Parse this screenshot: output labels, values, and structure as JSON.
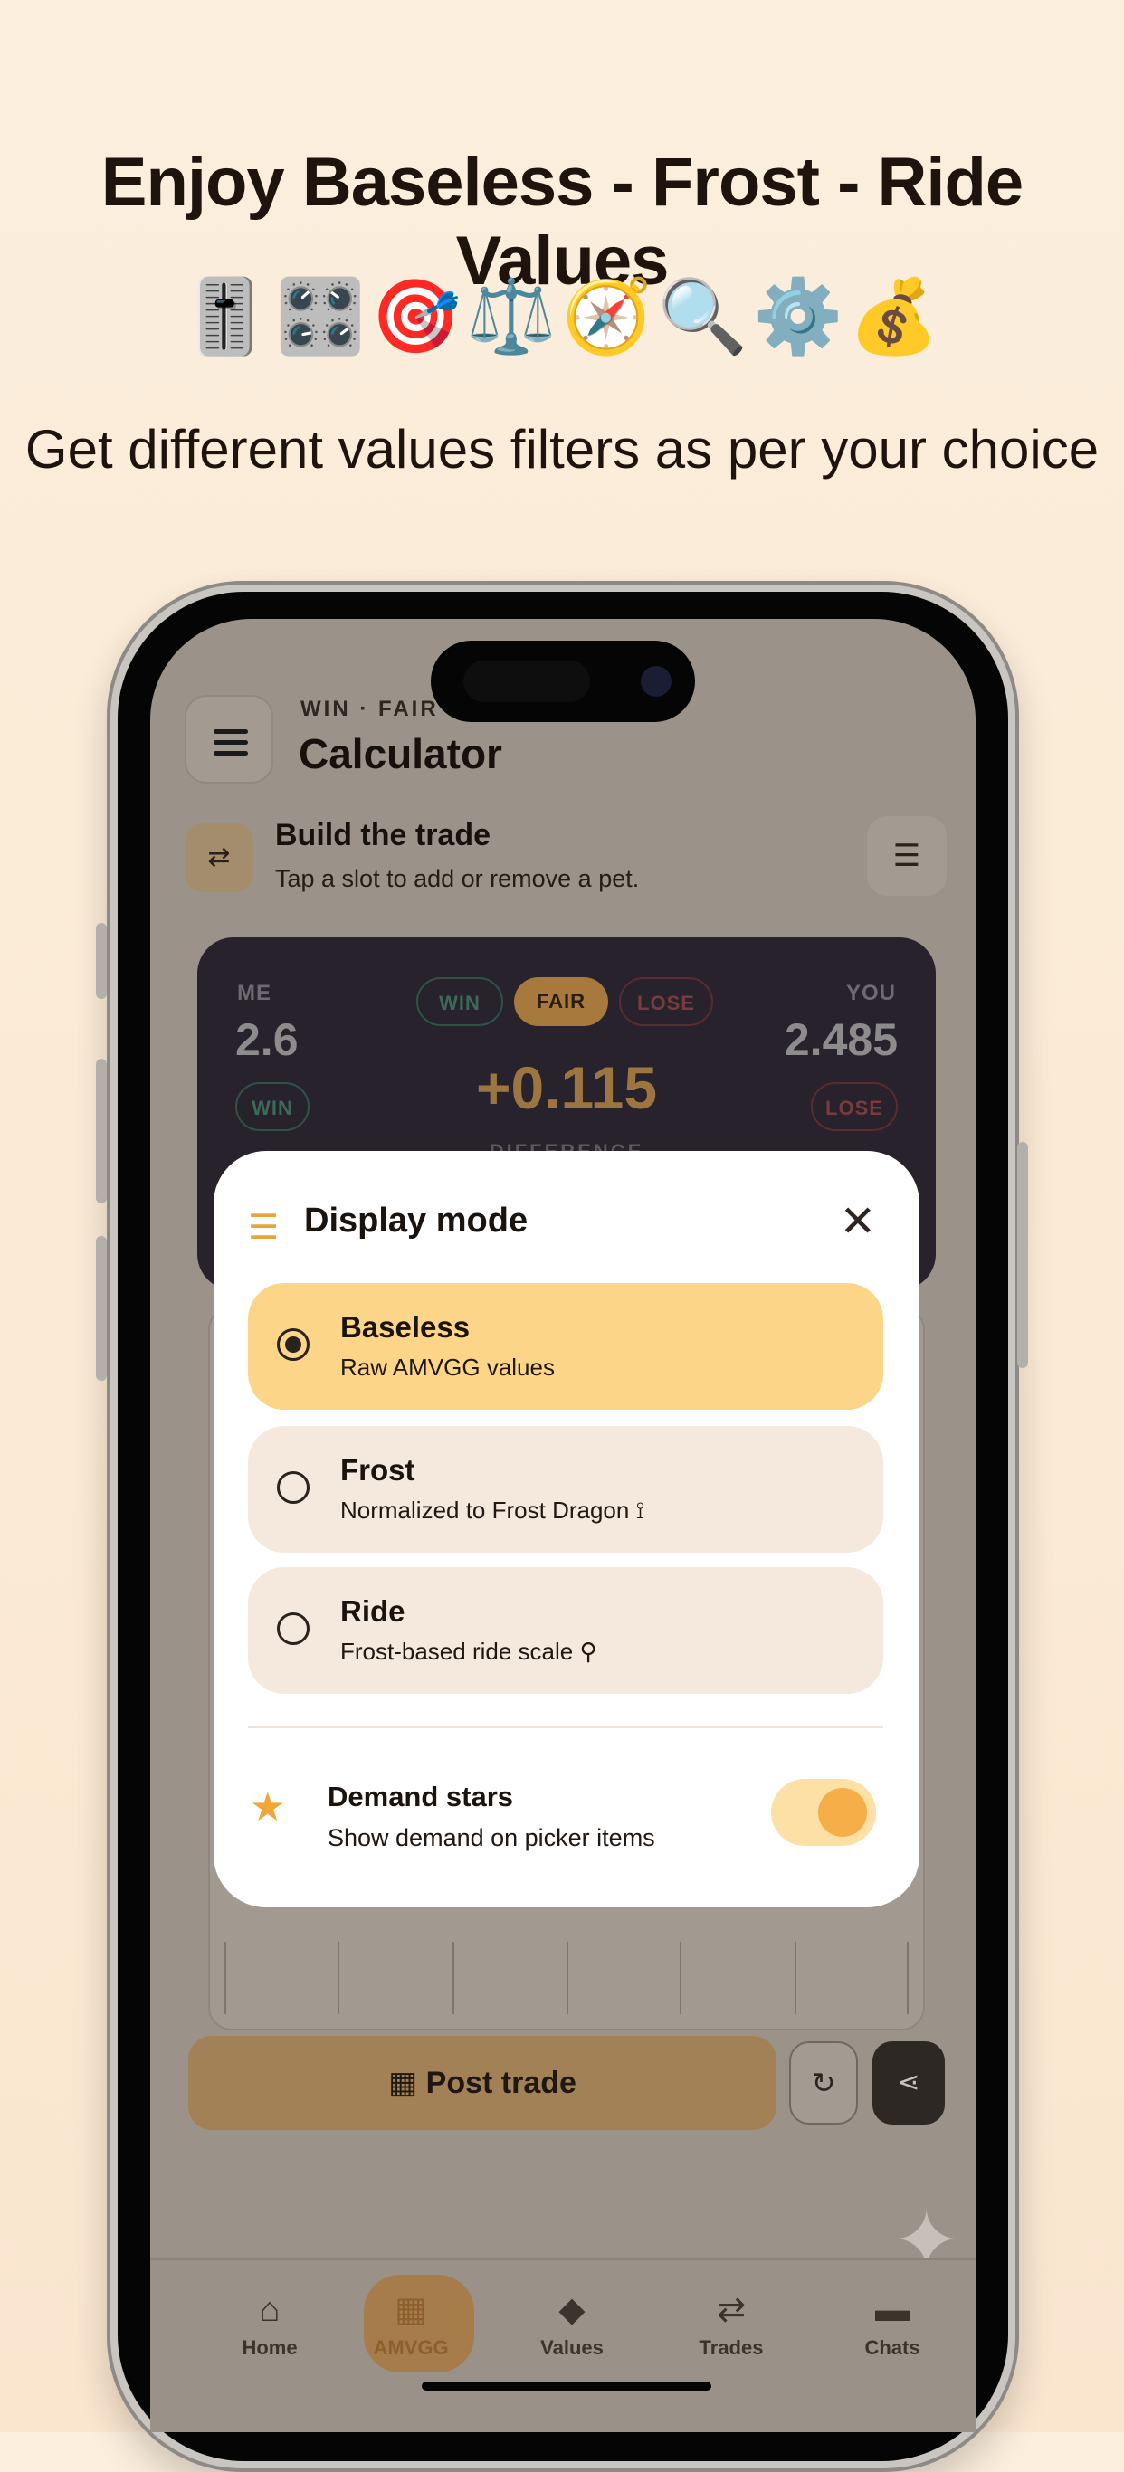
{
  "promo": {
    "headline": "Enjoy Baseless - Frost - Ride Values",
    "emojis": "🎚️🎛️🎯⚖️🧭🔍⚙️💰",
    "subheadline": "Get different values filters as per your choice"
  },
  "header": {
    "eyebrow": "WIN · FAIR ·",
    "title": "Calculator"
  },
  "build": {
    "title": "Build the trade",
    "subtitle": "Tap a slot to add or remove a pet."
  },
  "score": {
    "me_label": "ME",
    "me_value": "2.6",
    "me_chip": "WIN",
    "you_label": "YOU",
    "you_value": "2.485",
    "you_chip": "LOSE",
    "filters": [
      "WIN",
      "FAIR",
      "LOSE"
    ],
    "difference": "+0.115",
    "difference_label": "DIFFERENCE"
  },
  "actions": {
    "post_label": "Post trade"
  },
  "tabs": [
    {
      "label": "Home",
      "icon": "home-icon"
    },
    {
      "label": "AMVGG",
      "icon": "calculator-icon"
    },
    {
      "label": "Values",
      "icon": "diamond-icon"
    },
    {
      "label": "Trades",
      "icon": "swap-icon"
    },
    {
      "label": "Chats",
      "icon": "chat-icon"
    }
  ],
  "modal": {
    "title": "Display mode",
    "options": [
      {
        "title": "Baseless",
        "subtitle": "Raw AMVGG values",
        "selected": true
      },
      {
        "title": "Frost",
        "subtitle": "Normalized to Frost Dragon",
        "selected": false
      },
      {
        "title": "Ride",
        "subtitle": "Frost-based ride scale",
        "selected": false
      }
    ],
    "demand": {
      "title": "Demand stars",
      "subtitle": "Show demand on picker items",
      "enabled": true
    }
  },
  "colors": {
    "accent": "#F6AE48",
    "selected_option": "#FDD589",
    "background": "#FBEEDD"
  }
}
